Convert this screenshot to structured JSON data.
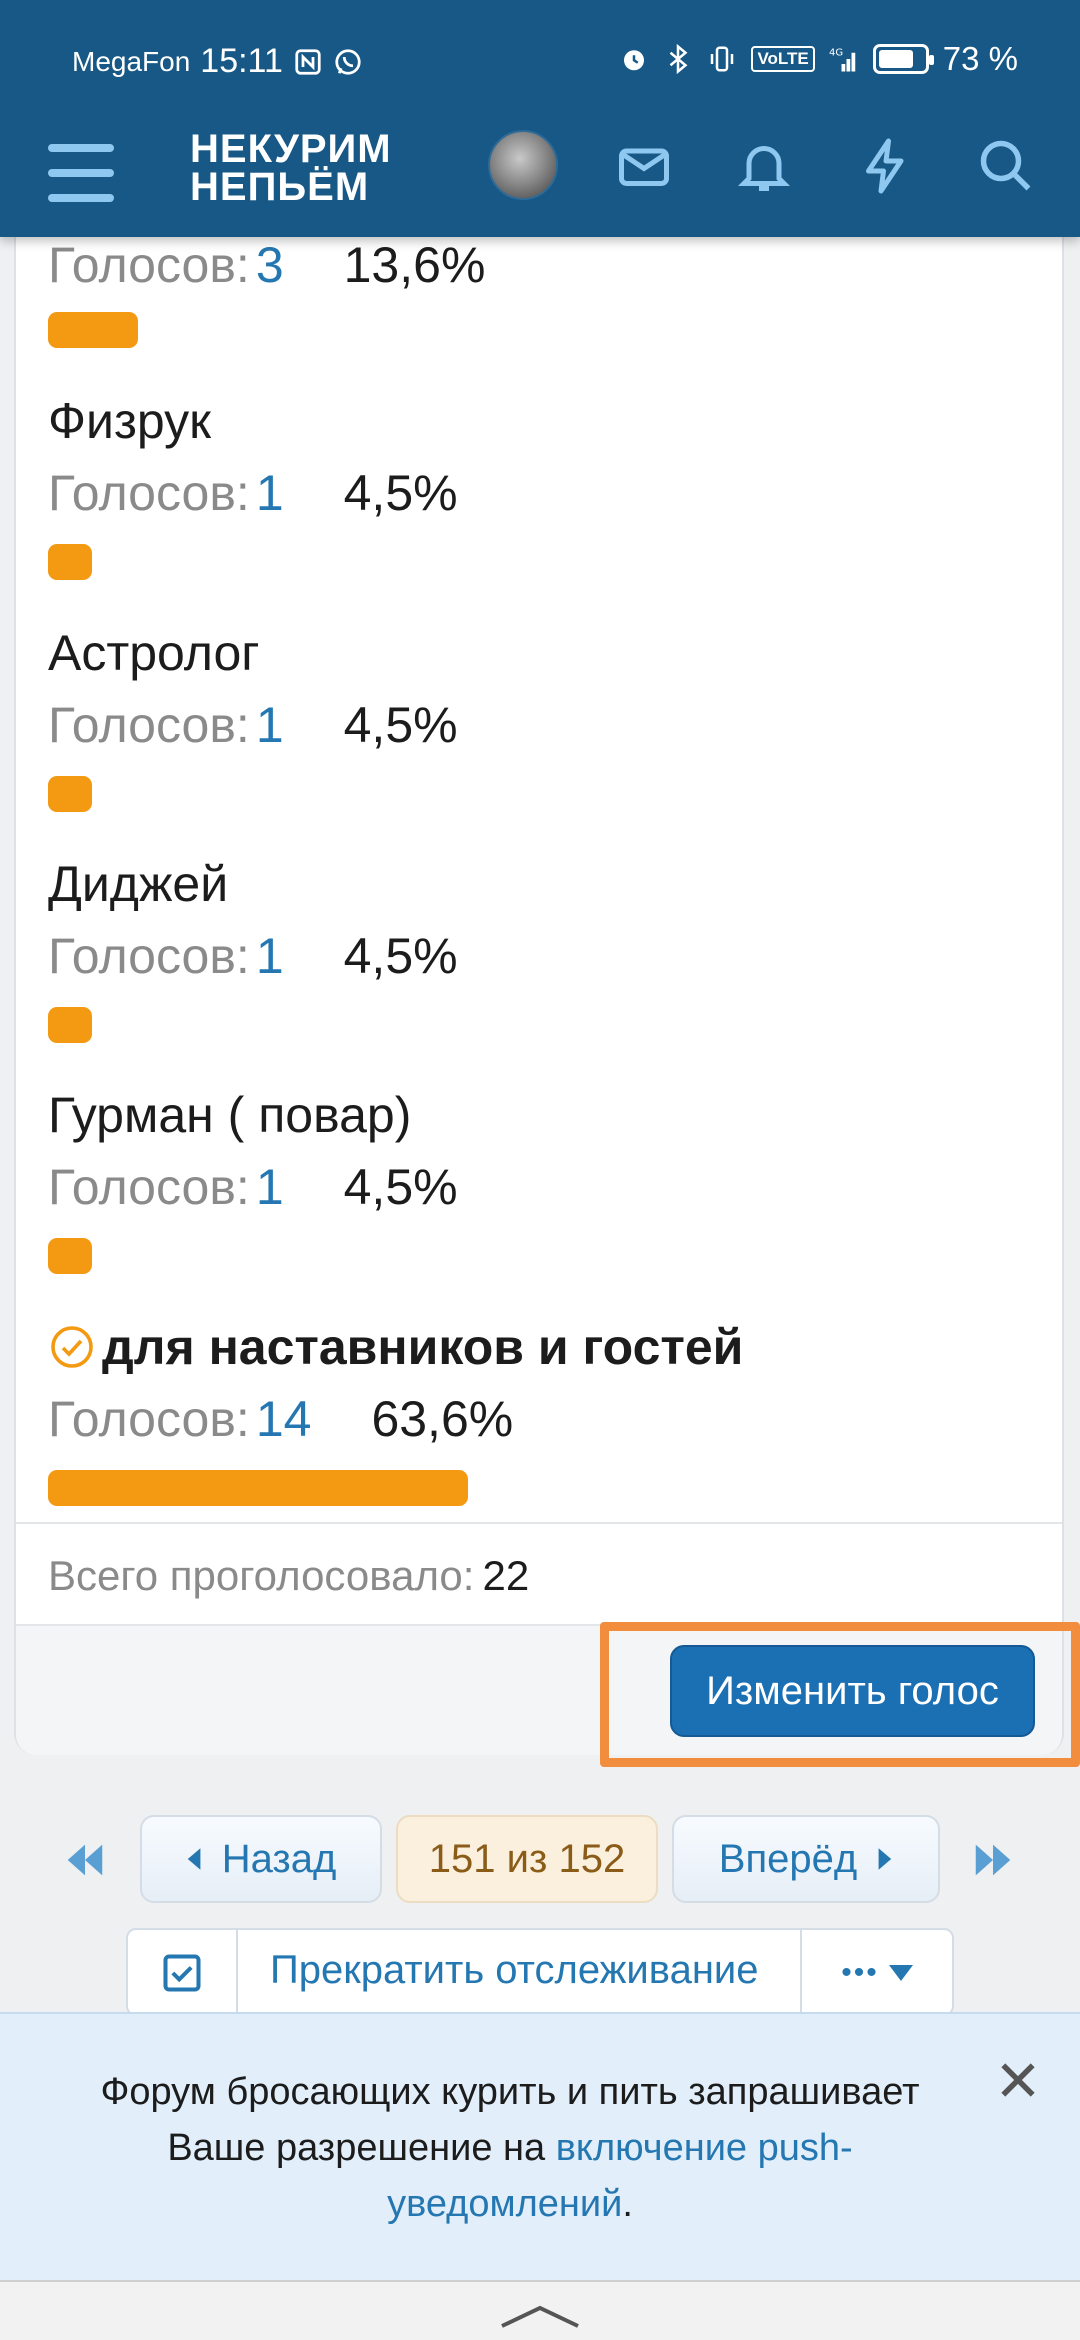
{
  "status_bar": {
    "carrier": "MegaFon",
    "time": "15:11",
    "volte": "VoLTE",
    "network": "4G",
    "battery": "73 %"
  },
  "header": {
    "logo_line1": "НЕКУРИМ",
    "logo_line2": "НЕПЬЁМ"
  },
  "poll": {
    "votes_label": "Голосов:",
    "options": [
      {
        "name": "",
        "votes": "3",
        "percent": "13,6%",
        "fraction": 0.136
      },
      {
        "name": "Физрук",
        "votes": "1",
        "percent": "4,5%",
        "fraction": 0.045
      },
      {
        "name": "Астролог",
        "votes": "1",
        "percent": "4,5%",
        "fraction": 0.045
      },
      {
        "name": "Диджей",
        "votes": "1",
        "percent": "4,5%",
        "fraction": 0.045
      },
      {
        "name": "Гурман ( повар)",
        "votes": "1",
        "percent": "4,5%",
        "fraction": 0.045
      },
      {
        "name": "для наставников и гостей",
        "votes": "14",
        "percent": "63,6%",
        "fraction": 0.636,
        "selected": true
      }
    ],
    "total_label": "Всего проголосовало:",
    "total_value": "22",
    "change_vote_label": "Изменить голос",
    "highlight_color": "#f28d3e",
    "bar_color": "#f39a12"
  },
  "pagination": {
    "prev_label": "Назад",
    "current": "151 из 152",
    "next_label": "Вперёд"
  },
  "watch": {
    "label": "Прекратить отслеживание",
    "more": "•••"
  },
  "push_notice": {
    "text_before": "Форум бросающих курить и пить запрашивает Ваше разрешение на ",
    "link": "включение push-уведомлений",
    "text_after": "."
  },
  "icons": {
    "menu": "hamburger-menu-icon",
    "mail": "mail-icon",
    "bell": "bell-icon",
    "bolt": "lightning-icon",
    "search": "search-icon",
    "check": "check-circle-icon",
    "close": "close-icon"
  }
}
